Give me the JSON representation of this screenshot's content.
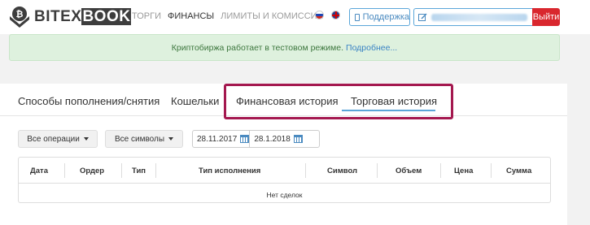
{
  "header": {
    "brand_pre": "BITEX",
    "brand_post": "BOOK",
    "nav": [
      "ТОРГИ",
      "ФИНАНСЫ",
      "ЛИМИТЫ И КОМИССИИ"
    ],
    "support_label": "Поддержка",
    "logout_label": "Выйти"
  },
  "alert": {
    "text": "Криптобиржа работает в тестовом режиме.",
    "link": "Подробнее..."
  },
  "tabs": [
    "Способы пополнения/снятия",
    "Кошельки",
    "Финансовая история",
    "Торговая история"
  ],
  "active_tab": "Торговая история",
  "filters": {
    "operations": "Все операции",
    "symbols": "Все символы",
    "date_from": "28.11.2017",
    "date_to": "28.1.2018"
  },
  "table": {
    "columns": [
      "Дата",
      "Ордер",
      "Тип",
      "Тип исполнения",
      "Символ",
      "Объем",
      "Цена",
      "Сумма"
    ],
    "empty_text": "Нет сделок"
  },
  "colors": {
    "accent": "#5ba6d9",
    "alert_bg": "#def1de",
    "logout": "#d9272e",
    "highlight": "#a4184f"
  }
}
